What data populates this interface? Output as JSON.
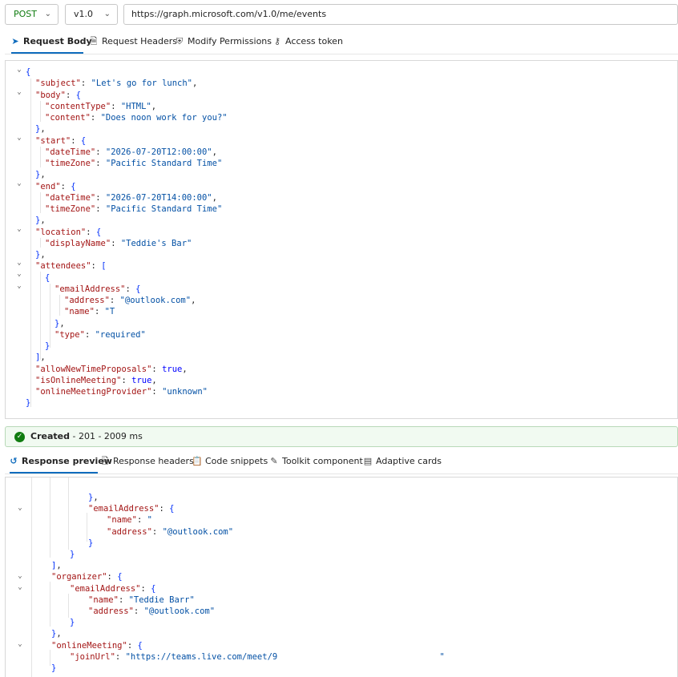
{
  "toolbar": {
    "method": "POST",
    "version": "v1.0",
    "url": "https://graph.microsoft.com/v1.0/me/events"
  },
  "request_tabs": [
    {
      "label": "Request Body",
      "icon": "send-icon",
      "active": true
    },
    {
      "label": "Request Headers",
      "icon": "document-icon",
      "active": false
    },
    {
      "label": "Modify Permissions",
      "icon": "shield-icon",
      "active": false
    },
    {
      "label": "Access token",
      "icon": "key-icon",
      "active": false
    }
  ],
  "request_body": [
    "{",
    "\"subject\": \"Let's go for lunch\",",
    "\"body\": {",
    "\"contentType\": \"HTML\",",
    "\"content\": \"Does noon work for you?\"",
    "},",
    "\"start\": {",
    "\"dateTime\": \"2026-07-20T12:00:00\",",
    "\"timeZone\": \"Pacific Standard Time\"",
    "},",
    "\"end\": {",
    "\"dateTime\": \"2026-07-20T14:00:00\",",
    "\"timeZone\": \"Pacific Standard Time\"",
    "},",
    "\"location\": {",
    "\"displayName\": \"Teddie's Bar\"",
    "},",
    "\"attendees\": [",
    "{",
    "\"emailAddress\": {",
    "\"address\": \"@outlook.com\",",
    "\"name\": \"T",
    "},",
    "\"type\": \"required\"",
    "}",
    "],",
    "\"allowNewTimeProposals\": true,",
    "\"isOnlineMeeting\": true,",
    "\"onlineMeetingProvider\": \"unknown\"",
    "}"
  ],
  "status": {
    "label": "Created",
    "detail": " - 201 - 2009 ms"
  },
  "response_tabs": [
    {
      "label": "Response preview",
      "icon": "preview-icon",
      "active": true
    },
    {
      "label": "Response headers",
      "icon": "headers-icon",
      "active": false
    },
    {
      "label": "Code snippets",
      "icon": "code-icon",
      "active": false
    },
    {
      "label": "Toolkit component",
      "icon": "toolkit-icon",
      "active": false
    },
    {
      "label": "Adaptive cards",
      "icon": "card-icon",
      "active": false
    }
  ],
  "response_body": [
    "},",
    "\"emailAddress\": {",
    "\"name\": \"",
    "\"address\": \"@outlook.com\"",
    "}",
    "}",
    "],",
    "\"organizer\": {",
    "\"emailAddress\": {",
    "\"name\": \"Teddie Barr\"",
    "\"address\": \"@outlook.com\"",
    "}",
    "},",
    "\"onlineMeeting\": {",
    "\"joinUrl\": \"https://teams.live.com/meet/9                                \"",
    "}"
  ]
}
